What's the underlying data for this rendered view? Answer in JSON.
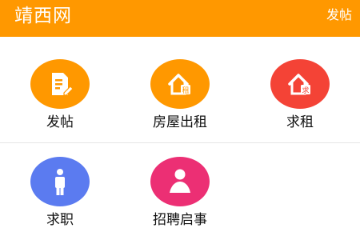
{
  "header": {
    "title": "靖西网",
    "action_label": "发帖",
    "background": "#ff9800"
  },
  "menu": {
    "items": [
      {
        "label": "发帖",
        "icon": "edit-document-icon",
        "color": "#ff9800"
      },
      {
        "label": "房屋出租",
        "icon": "house-rent-icon",
        "color": "#ff9800",
        "badge": "租"
      },
      {
        "label": "求租",
        "icon": "house-seek-icon",
        "color": "#f44336",
        "badge": "求"
      },
      {
        "label": "求职",
        "icon": "job-seeker-icon",
        "color": "#5b7bf0"
      },
      {
        "label": "招聘启事",
        "icon": "recruit-person-icon",
        "color": "#ec2f74"
      }
    ]
  }
}
